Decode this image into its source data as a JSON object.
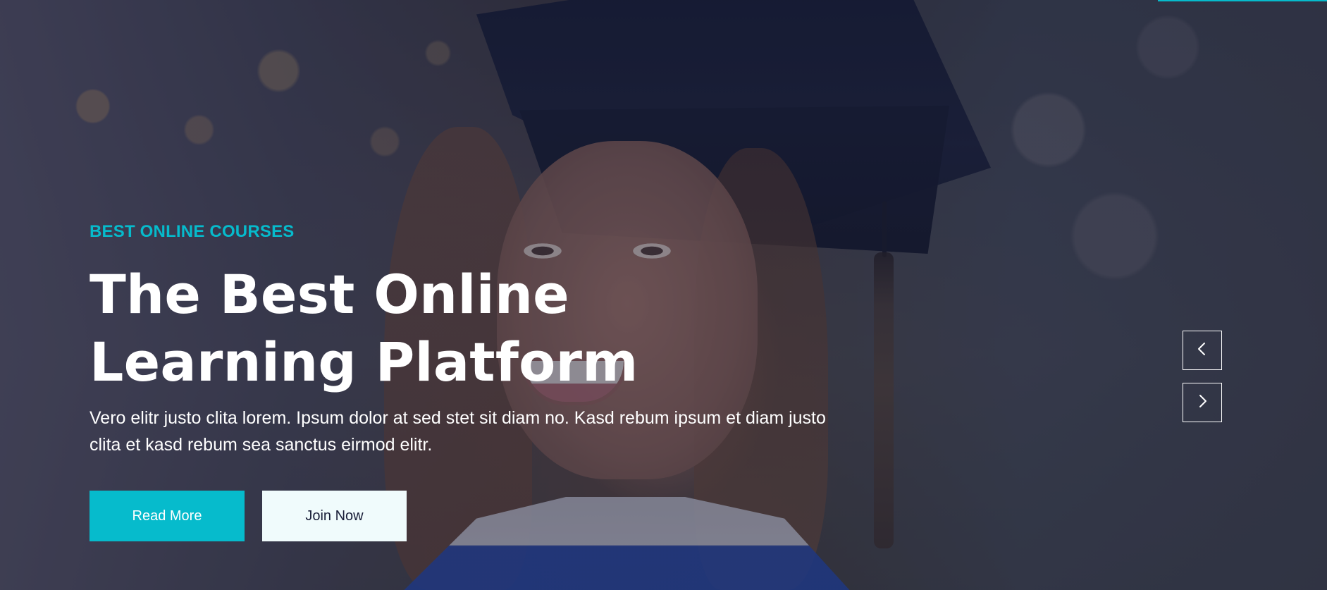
{
  "hero": {
    "eyebrow": "BEST ONLINE COURSES",
    "title": "The Best Online Learning Platform",
    "description": "Vero elitr justo clita lorem. Ipsum dolor at sed stet sit diam no. Kasd rebum ipsum et diam justo clita et kasd rebum sea sanctus eirmod elitr."
  },
  "buttons": {
    "read_more": "Read More",
    "join_now": "Join Now"
  },
  "carousel": {
    "previous_icon": "chevron-left-icon",
    "next_icon": "chevron-right-icon"
  },
  "colors": {
    "accent": "#06bbcc",
    "dark_text": "#181d38",
    "light_button": "#f0fbfc",
    "overlay": "#181d38"
  }
}
